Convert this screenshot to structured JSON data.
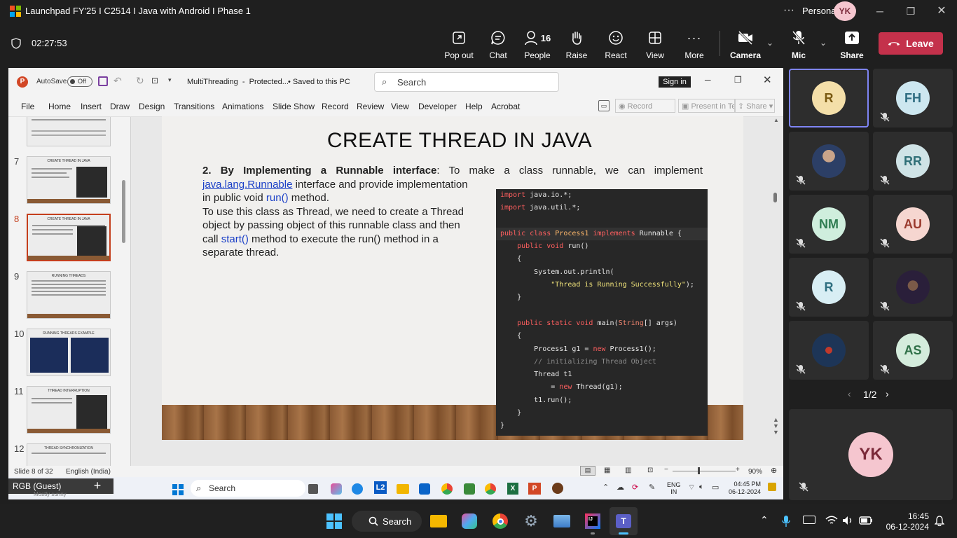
{
  "teams": {
    "window_title": "Launchpad FY'25 I C2514 I Java with Android I Phase 1",
    "profile_label": "Personal",
    "profile_initials": "YK",
    "timer": "02:27:53",
    "toolbar": [
      {
        "id": "popout",
        "label": "Pop out"
      },
      {
        "id": "chat",
        "label": "Chat"
      },
      {
        "id": "people",
        "label": "People",
        "badge": "16"
      },
      {
        "id": "raise",
        "label": "Raise"
      },
      {
        "id": "react",
        "label": "React"
      },
      {
        "id": "view",
        "label": "View"
      },
      {
        "id": "more",
        "label": "More"
      },
      {
        "id": "camera",
        "label": "Camera"
      },
      {
        "id": "mic",
        "label": "Mic"
      },
      {
        "id": "share",
        "label": "Share"
      }
    ],
    "leave_label": "Leave"
  },
  "ppt": {
    "autosave_label": "AutoSave",
    "autosave_state": "Off",
    "filename": "MultiThreading  -  Protected...",
    "saved_status": "• Saved to this PC",
    "search_placeholder": "Search",
    "signin_label": "Sign in",
    "menu": [
      "File",
      "Home",
      "Insert",
      "Draw",
      "Design",
      "Transitions",
      "Animations",
      "Slide Show",
      "Record",
      "Review",
      "View",
      "Developer",
      "Help",
      "Acrobat"
    ],
    "record_label": "Record",
    "present_label": "Present in Teams",
    "share_label": "Share",
    "thumbs": [
      {
        "num": "7",
        "title": "CREATE THREAD IN JAVA"
      },
      {
        "num": "8",
        "title": "CREATE THREAD IN JAVA"
      },
      {
        "num": "9",
        "title": "RUNNING THREADS"
      },
      {
        "num": "10",
        "title": "RUNNING THREADS EXAMPLE"
      },
      {
        "num": "11",
        "title": "THREAD INTERRUPTION"
      },
      {
        "num": "12",
        "title": "THREAD SYNCHRONIZATION"
      }
    ],
    "slide": {
      "title": "CREATE THREAD IN JAVA",
      "p1_bold": "2. By Implementing a Runnable interface",
      "p1_rest": ": To make a class runnable, we can implement",
      "p1_link": "java.lang.Runnable",
      "p1_line2": " interface and provide implementation",
      "p1_line3a": "in public void ",
      "p1_run": "run()",
      "p1_line3b": " method.",
      "p2_line1": "To use this class as Thread, we need to create a Thread",
      "p2_line2": "object by passing object of this runnable class and then",
      "p2_line3a": "call ",
      "p2_start": "start()",
      "p2_line3b": " method to execute the run() method in a",
      "p2_line4": "separate thread."
    },
    "code": {
      "l1a": "import",
      "l1b": " java.io.*;",
      "l2a": "import",
      "l2b": " java.util.*;",
      "l4a": "public class ",
      "l4b": "Process1",
      "l4c": " implements ",
      "l4d": "Runnable {",
      "l5a": "    public void ",
      "l5b": "run()",
      "l6": "    {",
      "l7": "        System.out.println(",
      "l8": "            \"Thread is Running Successfully\"",
      "l8b": ");",
      "l9": "    }",
      "l11a": "    public static void ",
      "l11b": "main(",
      "l11c": "String",
      "l11d": "[] args)",
      "l12": "    {",
      "l13a": "        Process1 g1 = ",
      "l13b": "new",
      "l13c": " Process1();",
      "l14": "        // initializing Thread Object",
      "l15": "        Thread t1",
      "l16a": "            = ",
      "l16b": "new",
      "l16c": " Thread(g1);",
      "l17": "        t1.run();",
      "l18": "    }",
      "l19": "}"
    },
    "status_slide": "Slide 8 of 32",
    "status_lang": "English (India)",
    "zoom": "90%"
  },
  "inner_taskbar": {
    "guest_label": "RGB (Guest)",
    "weather": "Mostly sunny",
    "search_label": "Search",
    "lang1": "ENG",
    "lang2": "IN",
    "time": "04:45 PM",
    "date": "06-12-2024"
  },
  "gallery": {
    "participants": [
      {
        "initials": "R",
        "bg": "#f4dfa9",
        "fg": "#7a5a12"
      },
      {
        "initials": "FH",
        "bg": "#cde7f0",
        "fg": "#2d6b80"
      },
      {
        "initials": "",
        "bg": "#6a7d95",
        "fg": "#fff"
      },
      {
        "initials": "RR",
        "bg": "#cfe3e6",
        "fg": "#2f6f77"
      },
      {
        "initials": "NM",
        "bg": "#cfeedd",
        "fg": "#2f7d52"
      },
      {
        "initials": "AU",
        "bg": "#f6d6d0",
        "fg": "#9a3a2e"
      },
      {
        "initials": "R",
        "bg": "#d8eef4",
        "fg": "#2f6f80"
      },
      {
        "initials": "",
        "bg": "#3a2a4a",
        "fg": "#fff"
      },
      {
        "initials": "",
        "bg": "#203a5a",
        "fg": "#fff"
      },
      {
        "initials": "AS",
        "bg": "#d4ecdc",
        "fg": "#2f7048"
      }
    ],
    "page": "1/2",
    "self_initials": "YK"
  },
  "taskbar": {
    "search_label": "Search",
    "time": "16:45",
    "date": "06-12-2024"
  }
}
